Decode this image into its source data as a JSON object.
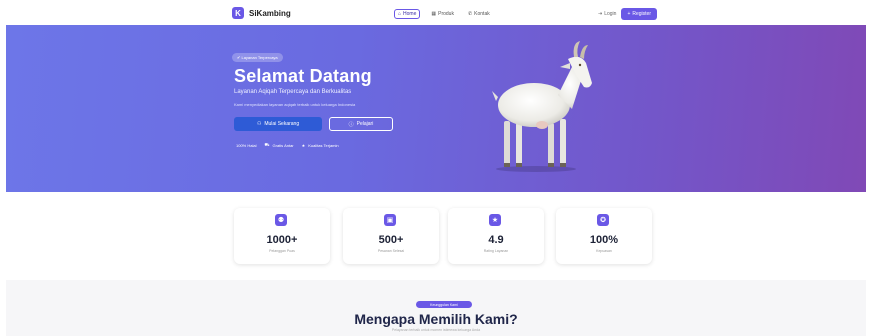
{
  "nav": {
    "brand_logo": "K",
    "brand_name": "SiKambing",
    "menu": [
      {
        "label": "Home",
        "icon": "home-icon",
        "active": true
      },
      {
        "label": "Produk",
        "icon": "grid-icon",
        "active": false
      },
      {
        "label": "Kontak",
        "icon": "phone-icon",
        "active": false
      }
    ],
    "login_label": "Login",
    "register_label": "Register"
  },
  "hero": {
    "badge": "Layanan Terpercaya",
    "title": "Selamat Datang",
    "subtitle": "Layanan Aqiqah Terpercaya dan Berkualitas",
    "description": "Kami menyediakan layanan aqiqah terbaik untuk keluarga Indonesia",
    "primary_button": "Mulai Sekarang",
    "outline_button": "Pelajari",
    "features": [
      "100% Halal",
      "Gratis Antar",
      "Kualitas Terjamin"
    ]
  },
  "stats": [
    {
      "value": "1000+",
      "label": "Pelanggan Puas",
      "icon": "users-icon"
    },
    {
      "value": "500+",
      "label": "Pesanan Selesai",
      "icon": "box-icon"
    },
    {
      "value": "4.9",
      "label": "Rating Layanan",
      "icon": "star-icon"
    },
    {
      "value": "100%",
      "label": "Kepuasan",
      "icon": "award-icon"
    }
  ],
  "why": {
    "badge": "Keunggulan Kami",
    "title": "Mengapa Memilih Kami?",
    "subtitle": "Pelayanan terbaik untuk momen istimewa keluarga Anda"
  },
  "colors": {
    "accent": "#6a58e6",
    "hero_start": "#6d76e8",
    "hero_end": "#8049b6",
    "primary_button": "#2e5bd6"
  }
}
